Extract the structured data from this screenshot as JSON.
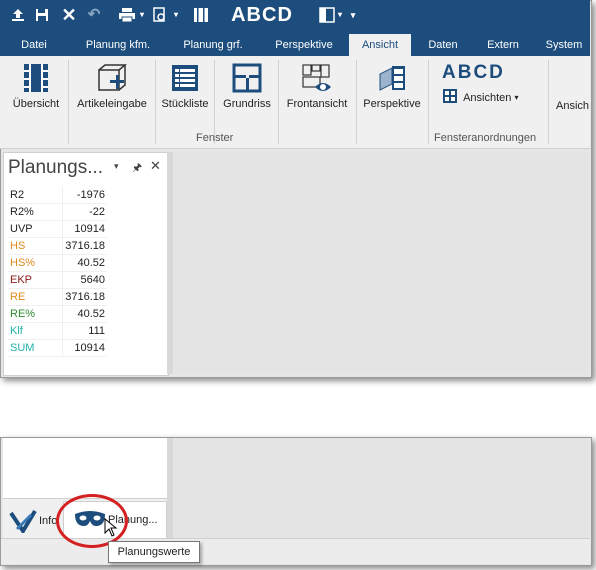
{
  "quick_access": {
    "abcd": "ABCD"
  },
  "tabs": [
    "Datei",
    "Planung kfm.",
    "Planung grf.",
    "Perspektive",
    "Ansicht",
    "Daten",
    "Extern",
    "System"
  ],
  "active_tab": "Ansicht",
  "ribbon": {
    "buttons": [
      "Übersicht",
      "Artikeleingabe",
      "Stückliste",
      "Grundriss",
      "Frontansicht",
      "Perspektive"
    ],
    "group_fenster": "Fenster",
    "abcd_label": "ABCD",
    "ansichten_label": "Ansichten",
    "group_fensteranordnungen": "Fensteranordnungen",
    "cut_label": "Ansich"
  },
  "panel": {
    "title": "Planungs...",
    "rows": [
      {
        "key": "R2",
        "value": "-1976",
        "color": "#222222"
      },
      {
        "key": "R2%",
        "value": "-22",
        "color": "#222222"
      },
      {
        "key": "UVP",
        "value": "10914",
        "color": "#222222"
      },
      {
        "key": "HS",
        "value": "3716.18",
        "color": "#e08a1e"
      },
      {
        "key": "HS%",
        "value": "40.52",
        "color": "#e08a1e"
      },
      {
        "key": "EKP",
        "value": "5640",
        "color": "#8b1a1a"
      },
      {
        "key": "RE",
        "value": "3716.18",
        "color": "#e08a1e"
      },
      {
        "key": "RE%",
        "value": "40.52",
        "color": "#2e8b2e"
      },
      {
        "key": "Klf",
        "value": "111",
        "color": "#20b2aa"
      },
      {
        "key": "SUM",
        "value": "10914",
        "color": "#20b2aa"
      }
    ]
  },
  "bottom_tabs": {
    "info": "Info",
    "planung": "Planung..."
  },
  "tooltip": "Planungswerte",
  "colors": {
    "title_bar": "#1d4d7d",
    "highlight_ring": "#d42020"
  }
}
